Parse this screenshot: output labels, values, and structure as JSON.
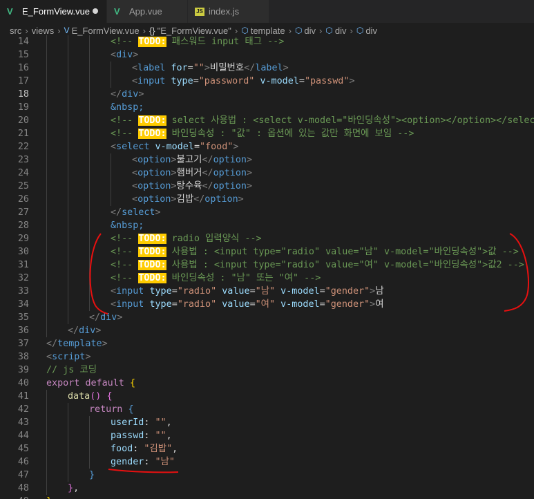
{
  "tabs": [
    {
      "label": "E_FormView.vue",
      "icon": "vue-icon",
      "active": true,
      "modified": true
    },
    {
      "label": "App.vue",
      "icon": "vue-icon",
      "active": false
    },
    {
      "label": "index.js",
      "icon": "js-icon",
      "active": false
    }
  ],
  "breadcrumb": [
    "src",
    "views",
    "E_FormView.vue",
    "\"E_FormView.vue\"",
    "template",
    "div",
    "div",
    "div"
  ],
  "current_line": 18,
  "lines": [
    {
      "n": 14,
      "indent": 3,
      "tokens": [
        [
          "com",
          "<!-- "
        ],
        [
          "todo",
          "TODO:"
        ],
        [
          "com",
          " 패스워드 input 태그 -->"
        ]
      ]
    },
    {
      "n": 15,
      "indent": 3,
      "tokens": [
        [
          "br",
          "<"
        ],
        [
          "tag",
          "div"
        ],
        [
          "br",
          ">"
        ]
      ]
    },
    {
      "n": 16,
      "indent": 4,
      "tokens": [
        [
          "br",
          "<"
        ],
        [
          "tag",
          "label"
        ],
        [
          "txt",
          " "
        ],
        [
          "attr",
          "for"
        ],
        [
          "txt",
          "="
        ],
        [
          "str",
          "\"\""
        ],
        [
          "br",
          ">"
        ],
        [
          "txt",
          "비밀번호"
        ],
        [
          "br",
          "</"
        ],
        [
          "tag",
          "label"
        ],
        [
          "br",
          ">"
        ]
      ]
    },
    {
      "n": 17,
      "indent": 4,
      "tokens": [
        [
          "br",
          "<"
        ],
        [
          "tag",
          "input"
        ],
        [
          "txt",
          " "
        ],
        [
          "attr",
          "type"
        ],
        [
          "txt",
          "="
        ],
        [
          "str",
          "\"password\""
        ],
        [
          "txt",
          " "
        ],
        [
          "attr",
          "v-model"
        ],
        [
          "txt",
          "="
        ],
        [
          "str",
          "\"passwd\""
        ],
        [
          "br",
          ">"
        ]
      ]
    },
    {
      "n": 18,
      "indent": 3,
      "tokens": [
        [
          "br",
          "</"
        ],
        [
          "tag",
          "div"
        ],
        [
          "br",
          ">"
        ]
      ]
    },
    {
      "n": 19,
      "indent": 3,
      "tokens": [
        [
          "ent",
          "&nbsp;"
        ]
      ]
    },
    {
      "n": 20,
      "indent": 3,
      "tokens": [
        [
          "com",
          "<!-- "
        ],
        [
          "todo",
          "TODO:"
        ],
        [
          "com",
          " select 사용법 : <select v-model=\"바인딩속성\"><option></option></select>"
        ]
      ]
    },
    {
      "n": 21,
      "indent": 3,
      "tokens": [
        [
          "com",
          "<!-- "
        ],
        [
          "todo",
          "TODO:"
        ],
        [
          "com",
          " 바인딩속성 : \"값\" : 옵션에 있는 값만 화면에 보임 -->"
        ]
      ]
    },
    {
      "n": 22,
      "indent": 3,
      "tokens": [
        [
          "br",
          "<"
        ],
        [
          "tag",
          "select"
        ],
        [
          "txt",
          " "
        ],
        [
          "attr",
          "v-model"
        ],
        [
          "txt",
          "="
        ],
        [
          "str",
          "\"food\""
        ],
        [
          "br",
          ">"
        ]
      ]
    },
    {
      "n": 23,
      "indent": 4,
      "tokens": [
        [
          "br",
          "<"
        ],
        [
          "tag",
          "option"
        ],
        [
          "br",
          ">"
        ],
        [
          "txt",
          "불고기"
        ],
        [
          "br",
          "</"
        ],
        [
          "tag",
          "option"
        ],
        [
          "br",
          ">"
        ]
      ]
    },
    {
      "n": 24,
      "indent": 4,
      "tokens": [
        [
          "br",
          "<"
        ],
        [
          "tag",
          "option"
        ],
        [
          "br",
          ">"
        ],
        [
          "txt",
          "햄버거"
        ],
        [
          "br",
          "</"
        ],
        [
          "tag",
          "option"
        ],
        [
          "br",
          ">"
        ]
      ]
    },
    {
      "n": 25,
      "indent": 4,
      "tokens": [
        [
          "br",
          "<"
        ],
        [
          "tag",
          "option"
        ],
        [
          "br",
          ">"
        ],
        [
          "txt",
          "탕수육"
        ],
        [
          "br",
          "</"
        ],
        [
          "tag",
          "option"
        ],
        [
          "br",
          ">"
        ]
      ]
    },
    {
      "n": 26,
      "indent": 4,
      "tokens": [
        [
          "br",
          "<"
        ],
        [
          "tag",
          "option"
        ],
        [
          "br",
          ">"
        ],
        [
          "txt",
          "김밥"
        ],
        [
          "br",
          "</"
        ],
        [
          "tag",
          "option"
        ],
        [
          "br",
          ">"
        ]
      ]
    },
    {
      "n": 27,
      "indent": 3,
      "tokens": [
        [
          "br",
          "</"
        ],
        [
          "tag",
          "select"
        ],
        [
          "br",
          ">"
        ]
      ]
    },
    {
      "n": 28,
      "indent": 3,
      "tokens": [
        [
          "ent",
          "&nbsp;"
        ]
      ]
    },
    {
      "n": 29,
      "indent": 3,
      "tokens": [
        [
          "com",
          "<!-- "
        ],
        [
          "todo",
          "TODO:"
        ],
        [
          "com",
          " radio 입력양식 -->"
        ]
      ]
    },
    {
      "n": 30,
      "indent": 3,
      "tokens": [
        [
          "com",
          "<!-- "
        ],
        [
          "todo",
          "TODO:"
        ],
        [
          "com",
          " 사용법 : <input type=\"radio\" value=\"남\" v-model=\"바인딩속성\">값 -->"
        ]
      ]
    },
    {
      "n": 31,
      "indent": 3,
      "tokens": [
        [
          "com",
          "<!-- "
        ],
        [
          "todo",
          "TODO:"
        ],
        [
          "com",
          " 사용법 : <input type=\"radio\" value=\"여\" v-model=\"바인딩속성\">값2 -->"
        ]
      ]
    },
    {
      "n": 32,
      "indent": 3,
      "tokens": [
        [
          "com",
          "<!-- "
        ],
        [
          "todo",
          "TODO:"
        ],
        [
          "com",
          " 바인딩속성 : \"남\" 또는 \"여\" -->"
        ]
      ]
    },
    {
      "n": 33,
      "indent": 3,
      "tokens": [
        [
          "br",
          "<"
        ],
        [
          "tag",
          "input"
        ],
        [
          "txt",
          " "
        ],
        [
          "attr",
          "type"
        ],
        [
          "txt",
          "="
        ],
        [
          "str",
          "\"radio\""
        ],
        [
          "txt",
          " "
        ],
        [
          "attr",
          "value"
        ],
        [
          "txt",
          "="
        ],
        [
          "str",
          "\"남\""
        ],
        [
          "txt",
          " "
        ],
        [
          "attr",
          "v-model"
        ],
        [
          "txt",
          "="
        ],
        [
          "str",
          "\"gender\""
        ],
        [
          "br",
          ">"
        ],
        [
          "txt",
          "남"
        ]
      ]
    },
    {
      "n": 34,
      "indent": 3,
      "tokens": [
        [
          "br",
          "<"
        ],
        [
          "tag",
          "input"
        ],
        [
          "txt",
          " "
        ],
        [
          "attr",
          "type"
        ],
        [
          "txt",
          "="
        ],
        [
          "str",
          "\"radio\""
        ],
        [
          "txt",
          " "
        ],
        [
          "attr",
          "value"
        ],
        [
          "txt",
          "="
        ],
        [
          "str",
          "\"여\""
        ],
        [
          "txt",
          " "
        ],
        [
          "attr",
          "v-model"
        ],
        [
          "txt",
          "="
        ],
        [
          "str",
          "\"gender\""
        ],
        [
          "br",
          ">"
        ],
        [
          "txt",
          "여"
        ]
      ]
    },
    {
      "n": 35,
      "indent": 2,
      "tokens": [
        [
          "br",
          "</"
        ],
        [
          "tag",
          "div"
        ],
        [
          "br",
          ">"
        ]
      ]
    },
    {
      "n": 36,
      "indent": 1,
      "tokens": [
        [
          "br",
          "</"
        ],
        [
          "tag",
          "div"
        ],
        [
          "br",
          ">"
        ]
      ]
    },
    {
      "n": 37,
      "indent": 0,
      "tokens": [
        [
          "br",
          "</"
        ],
        [
          "tag",
          "template"
        ],
        [
          "br",
          ">"
        ]
      ]
    },
    {
      "n": 38,
      "indent": 0,
      "tokens": [
        [
          "br",
          "<"
        ],
        [
          "tag",
          "script"
        ],
        [
          "br",
          ">"
        ]
      ]
    },
    {
      "n": 39,
      "indent": 0,
      "tokens": [
        [
          "com",
          "// js 코딩"
        ]
      ]
    },
    {
      "n": 40,
      "indent": 0,
      "tokens": [
        [
          "kw",
          "export"
        ],
        [
          "txt",
          " "
        ],
        [
          "kw",
          "default"
        ],
        [
          "txt",
          " "
        ],
        [
          "brace",
          "{"
        ]
      ]
    },
    {
      "n": 41,
      "indent": 1,
      "tokens": [
        [
          "fn",
          "data"
        ],
        [
          "brace2",
          "()"
        ],
        [
          "txt",
          " "
        ],
        [
          "brace2",
          "{"
        ]
      ]
    },
    {
      "n": 42,
      "indent": 2,
      "tokens": [
        [
          "kw",
          "return"
        ],
        [
          "txt",
          " "
        ],
        [
          "key",
          "{"
        ]
      ]
    },
    {
      "n": 43,
      "indent": 3,
      "tokens": [
        [
          "attr",
          "userId"
        ],
        [
          "txt",
          ": "
        ],
        [
          "str",
          "\"\""
        ],
        [
          "txt",
          ","
        ]
      ]
    },
    {
      "n": 44,
      "indent": 3,
      "tokens": [
        [
          "attr",
          "passwd"
        ],
        [
          "txt",
          ": "
        ],
        [
          "str",
          "\"\""
        ],
        [
          "txt",
          ","
        ]
      ]
    },
    {
      "n": 45,
      "indent": 3,
      "tokens": [
        [
          "attr",
          "food"
        ],
        [
          "txt",
          ": "
        ],
        [
          "str",
          "\"김밥\""
        ],
        [
          "txt",
          ","
        ]
      ]
    },
    {
      "n": 46,
      "indent": 3,
      "tokens": [
        [
          "attr",
          "gender"
        ],
        [
          "txt",
          ": "
        ],
        [
          "str",
          "\"남\""
        ]
      ]
    },
    {
      "n": 47,
      "indent": 2,
      "tokens": [
        [
          "key",
          "}"
        ]
      ]
    },
    {
      "n": 48,
      "indent": 1,
      "tokens": [
        [
          "brace2",
          "}"
        ],
        [
          "txt",
          ","
        ]
      ]
    },
    {
      "n": 49,
      "indent": 0,
      "tokens": [
        [
          "brace",
          "}"
        ]
      ]
    }
  ]
}
